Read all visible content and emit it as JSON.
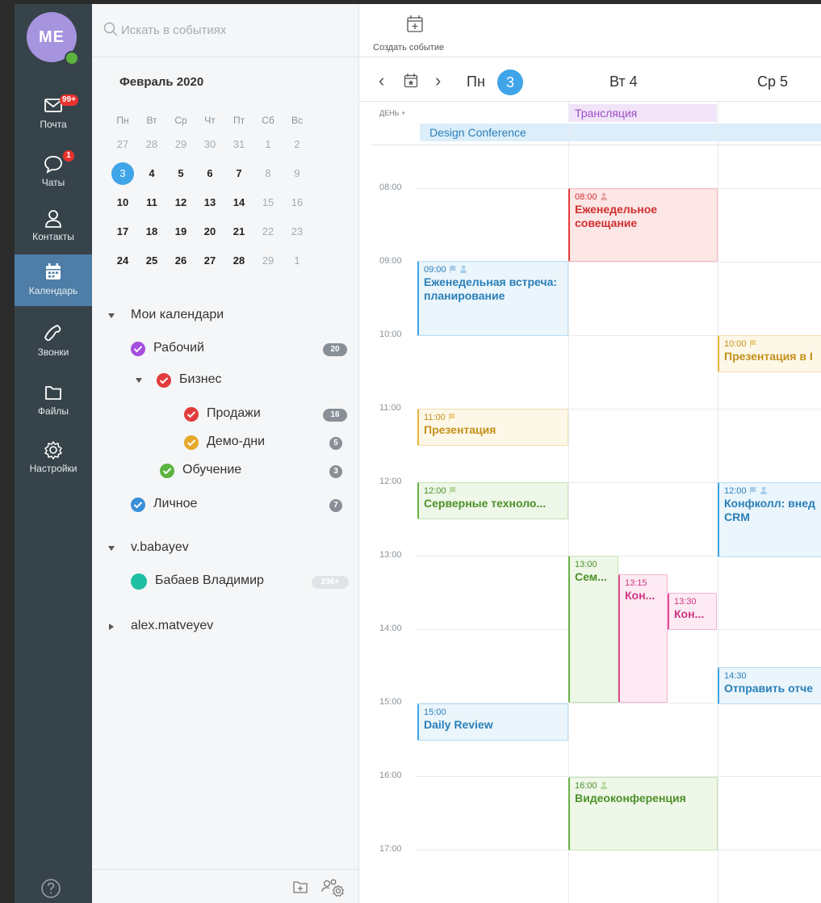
{
  "user": {
    "initials": "ME"
  },
  "nav": {
    "items": [
      {
        "label": "Почта",
        "badge": "99+"
      },
      {
        "label": "Чаты",
        "badge": "1"
      },
      {
        "label": "Контакты"
      },
      {
        "label": "Календарь"
      },
      {
        "label": "Звонки"
      },
      {
        "label": "Файлы"
      },
      {
        "label": "Настройки"
      }
    ],
    "active": "Календарь"
  },
  "search": {
    "placeholder": "Искать в событиях"
  },
  "mini_calendar": {
    "title": "Февраль 2020",
    "weekdays": [
      "Пн",
      "Вт",
      "Ср",
      "Чт",
      "Пт",
      "Сб",
      "Вс"
    ],
    "weeks": [
      [
        "27",
        "28",
        "29",
        "30",
        "31",
        "1",
        "2"
      ],
      [
        "3",
        "4",
        "5",
        "6",
        "7",
        "8",
        "9"
      ],
      [
        "10",
        "11",
        "12",
        "13",
        "14",
        "15",
        "16"
      ],
      [
        "17",
        "18",
        "19",
        "20",
        "21",
        "22",
        "23"
      ],
      [
        "24",
        "25",
        "26",
        "27",
        "28",
        "29",
        "1"
      ]
    ],
    "today": "3"
  },
  "calendars": {
    "my_title": "Мои календари",
    "work": {
      "label": "Рабочий",
      "count": "20",
      "color": "#a64ee0"
    },
    "business": {
      "label": "Бизнес",
      "color": "#e23b3b"
    },
    "sales": {
      "label": "Продажи",
      "count": "16",
      "color": "#e23b3b"
    },
    "demo": {
      "label": "Демо-дни",
      "count": "5",
      "color": "#e6a82a"
    },
    "training": {
      "label": "Обучение",
      "count": "3",
      "color": "#5cb33e"
    },
    "personal": {
      "label": "Личное",
      "count": "7",
      "color": "#3b8fd9"
    },
    "user1_title": "v.babayev",
    "user1_cal": {
      "label": "Бабаев Владимир",
      "count": "236+",
      "color": "#1fbfa3"
    },
    "user2_title": "alex.matveyev"
  },
  "toolbar": {
    "create_label": "Создать событие"
  },
  "days": {
    "d1": {
      "name": "Пн",
      "num": "3"
    },
    "d2": "Вт 4",
    "d3": "Ср 5"
  },
  "allday": {
    "label": "ДЕНЬ +",
    "events": [
      "Трансляция",
      "Design Conference"
    ]
  },
  "hours": [
    "08:00",
    "09:00",
    "10:00",
    "11:00",
    "12:00",
    "13:00",
    "14:00",
    "15:00",
    "16:00",
    "17:00"
  ],
  "events": {
    "e1": {
      "time": "08:00",
      "title": "Еженедельное совещание"
    },
    "e2": {
      "time": "09:00",
      "title": "Еженедельная встреча: планирование"
    },
    "e3": {
      "time": "10:00",
      "title": "Презентация в I"
    },
    "e4": {
      "time": "11:00",
      "title": "Презентация"
    },
    "e5": {
      "time": "12:00",
      "title": "Серверные техноло..."
    },
    "e6": {
      "time": "12:00",
      "title": "Конфколл: внед CRM"
    },
    "e7": {
      "time": "13:00",
      "title": "Сем..."
    },
    "e8": {
      "time": "13:15",
      "title": "Кон..."
    },
    "e9": {
      "time": "13:30",
      "title": "Кон..."
    },
    "e10": {
      "time": "14:30",
      "title": "Отправить отче"
    },
    "e11": {
      "time": "15:00",
      "title": "Daily Review"
    },
    "e12": {
      "time": "16:00",
      "title": "Видеоконференция"
    }
  }
}
